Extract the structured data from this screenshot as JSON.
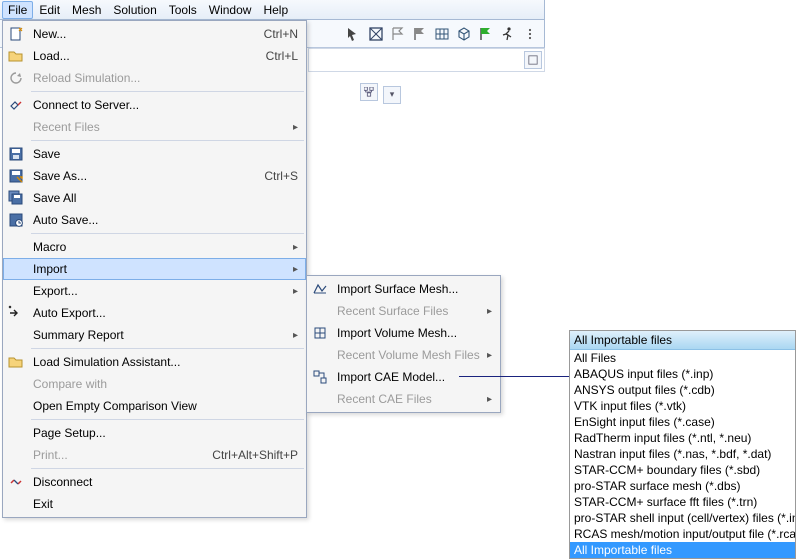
{
  "menubar": {
    "items": [
      "File",
      "Edit",
      "Mesh",
      "Solution",
      "Tools",
      "Window",
      "Help"
    ],
    "open_index": 0
  },
  "file_menu": {
    "new": {
      "label": "New...",
      "accel": "Ctrl+N"
    },
    "load": {
      "label": "Load...",
      "accel": "Ctrl+L"
    },
    "reload": {
      "label": "Reload Simulation..."
    },
    "connect": {
      "label": "Connect to Server..."
    },
    "recent_files": {
      "label": "Recent Files"
    },
    "save": {
      "label": "Save"
    },
    "save_as": {
      "label": "Save As...",
      "accel": "Ctrl+S"
    },
    "save_all": {
      "label": "Save All"
    },
    "auto_save": {
      "label": "Auto Save..."
    },
    "macro": {
      "label": "Macro"
    },
    "import": {
      "label": "Import"
    },
    "export": {
      "label": "Export..."
    },
    "auto_export": {
      "label": "Auto Export..."
    },
    "summary": {
      "label": "Summary Report"
    },
    "load_assist": {
      "label": "Load Simulation Assistant..."
    },
    "compare": {
      "label": "Compare with"
    },
    "open_compare": {
      "label": "Open Empty Comparison View"
    },
    "page_setup": {
      "label": "Page Setup..."
    },
    "print": {
      "label": "Print...",
      "accel": "Ctrl+Alt+Shift+P"
    },
    "disconnect": {
      "label": "Disconnect"
    },
    "exit": {
      "label": "Exit"
    }
  },
  "import_menu": {
    "surface": {
      "label": "Import Surface Mesh..."
    },
    "recent_surface": {
      "label": "Recent Surface Files"
    },
    "volume": {
      "label": "Import Volume Mesh..."
    },
    "recent_volume": {
      "label": "Recent Volume Mesh Files"
    },
    "cae": {
      "label": "Import CAE Model..."
    },
    "recent_cae": {
      "label": "Recent CAE Files"
    }
  },
  "typebox": {
    "header": "All Importable files",
    "options": [
      "All Files",
      "ABAQUS input files (*.inp)",
      "ANSYS output files (*.cdb)",
      "VTK input files (*.vtk)",
      "EnSight input files (*.case)",
      "RadTherm input files (*.ntl, *.neu)",
      "Nastran input files (*.nas, *.bdf, *.dat)",
      "STAR-CCM+ boundary files (*.sbd)",
      "pro-STAR surface mesh (*.dbs)",
      "STAR-CCM+ surface fft files (*.trn)",
      "pro-STAR shell input (cell/vertex) files (*.inp)",
      "RCAS mesh/motion input/output file (*.rcas, *.in)",
      "All Importable files"
    ],
    "selected_index": 12
  },
  "arrow_glyph": "▸",
  "dropdown_glyph": "▾"
}
